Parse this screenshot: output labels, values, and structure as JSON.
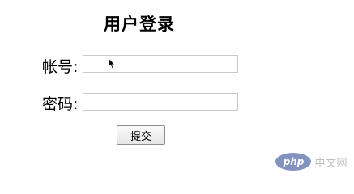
{
  "form": {
    "title": "用户登录",
    "account_label": "帐号:",
    "account_value": "",
    "password_label": "密码:",
    "password_value": "",
    "submit_label": "提交"
  },
  "watermark": {
    "logo_text": "php",
    "site_text": "中文网"
  },
  "colors": {
    "field_border": "#c9c9c9",
    "button_border": "#8d8d8d",
    "watermark_blue": "#6f7fb6",
    "watermark_gray": "#b8b8b8"
  },
  "icons": {
    "cursor": "mouse-pointer-icon"
  }
}
